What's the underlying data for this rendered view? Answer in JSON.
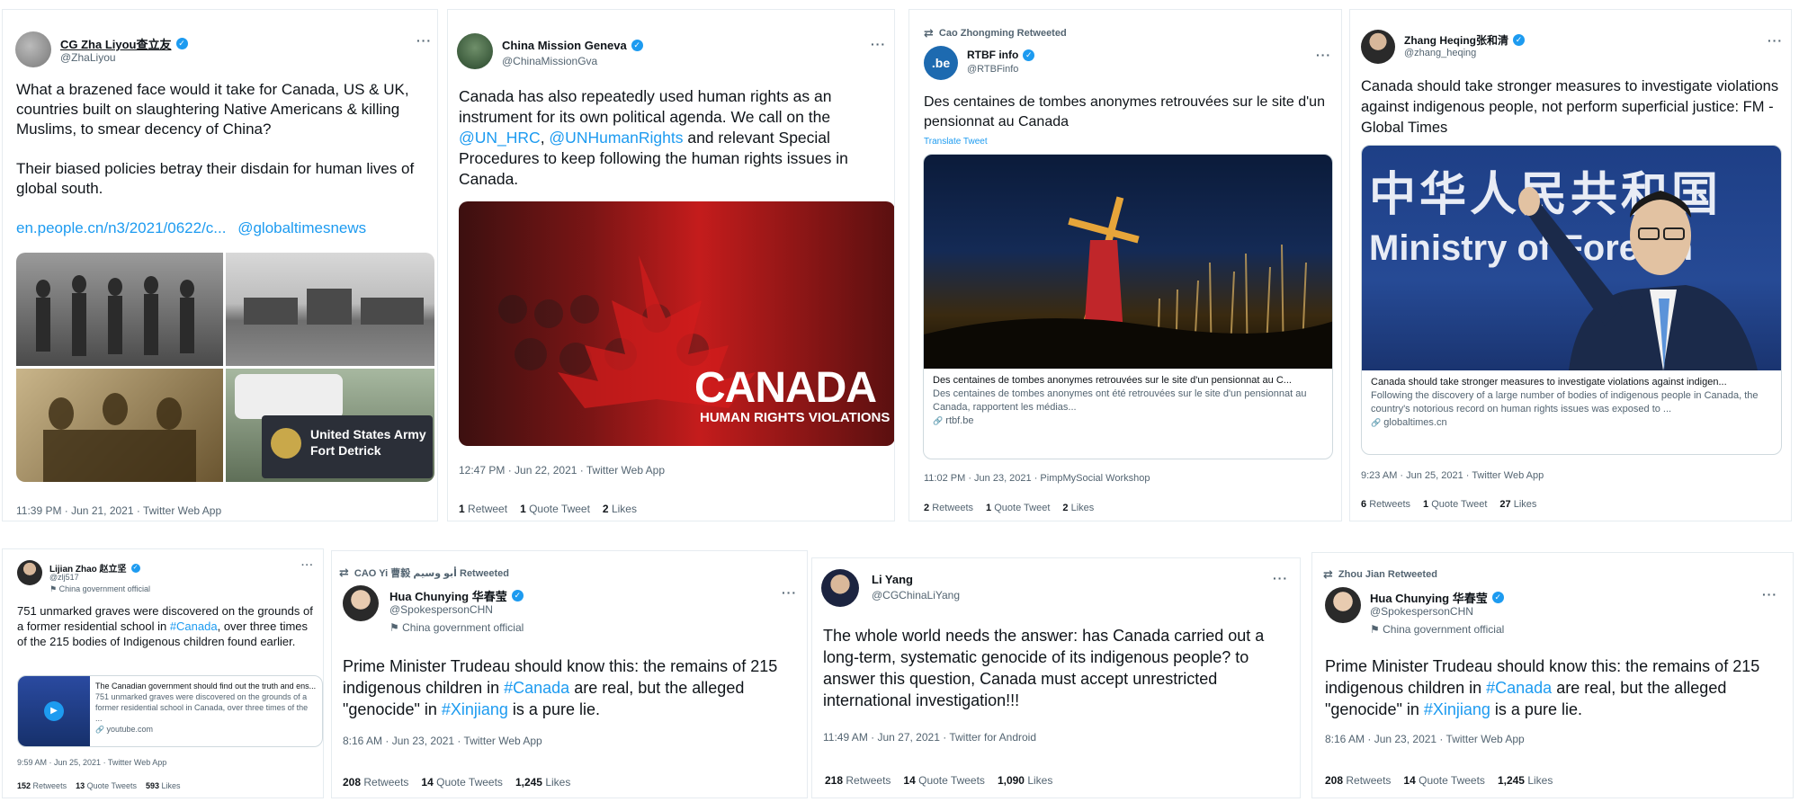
{
  "tweets": [
    {
      "name": "CG Zha Liyou查立友",
      "handle": "@ZhaLiyou",
      "text1": "What a brazened face would it take for Canada, US & UK, countries built on slaughtering Native Americans & killing Muslims, to smear decency of China?",
      "text2": "Their biased policies betray their disdain for human lives of global south.",
      "link": "en.people.cn/n3/2021/0622/c...",
      "mention": "@globaltimesnews",
      "overlay_label": "United States Army Fort Detrick",
      "meta": "11:39 PM · Jun 21, 2021 · Twitter Web App"
    },
    {
      "name": "China Mission Geneva",
      "handle": "@ChinaMissionGva",
      "text_a": "Canada has also repeatedly used human rights as an instrument for its own political agenda. We call on the ",
      "mention1": "@UN_HRC",
      "sep": ", ",
      "mention2": "@UNHumanRights",
      "text_b": " and relevant Special Procedures to keep following the human rights issues in Canada.",
      "image_title": "CANADA",
      "image_subtitle": "HUMAN RIGHTS VIOLATIONS",
      "meta": "12:47 PM · Jun 22, 2021 · Twitter Web App",
      "stats": [
        {
          "num": "1",
          "label": "Retweet"
        },
        {
          "num": "1",
          "label": "Quote Tweet"
        },
        {
          "num": "2",
          "label": "Likes"
        }
      ]
    },
    {
      "retweeted_by": "Cao Zhongming Retweeted",
      "name": "RTBF info",
      "handle": "@RTBFinfo",
      "avatar_text": ".be",
      "text": "Des centaines de tombes anonymes retrouvées sur le site d'un pensionnat au Canada",
      "translate": "Translate Tweet",
      "card_title": "Des centaines de tombes anonymes retrouvées sur le site d'un pensionnat au C...",
      "card_desc": "Des centaines de tombes anonymes ont été retrouvées sur le site d'un pensionnat au Canada, rapportent les médias...",
      "card_domain": "rtbf.be",
      "meta": "11:02 PM · Jun 23, 2021 · PimpMySocial Workshop",
      "stats": [
        {
          "num": "2",
          "label": "Retweets"
        },
        {
          "num": "1",
          "label": "Quote Tweet"
        },
        {
          "num": "2",
          "label": "Likes"
        }
      ]
    },
    {
      "name": "Zhang Heqing张和清",
      "handle": "@zhang_heqing",
      "text": "Canada should take stronger measures to investigate violations against indigenous people, not perform superficial justice: FM - Global Times",
      "image_zh": "中华人民共和国",
      "image_en": "Ministry of Foreign",
      "card_title": "Canada should take stronger measures to investigate violations against indigen...",
      "card_desc": "Following the discovery of a large number of bodies of indigenous people in Canada, the country's notorious record on human rights issues was exposed to ...",
      "card_domain": "globaltimes.cn",
      "meta": "9:23 AM · Jun 25, 2021 · Twitter Web App",
      "stats": [
        {
          "num": "6",
          "label": "Retweets"
        },
        {
          "num": "1",
          "label": "Quote Tweet"
        },
        {
          "num": "27",
          "label": "Likes"
        }
      ]
    },
    {
      "name": "Lijian Zhao 赵立坚",
      "handle": "@zlj517",
      "official": "China government official",
      "text_a": "751 unmarked graves were discovered on the grounds of a former residential school in ",
      "hashtag": "#Canada",
      "text_b": ", over three times of the 215 bodies of Indigenous children found earlier.",
      "card_title": "The Canadian government should find out the truth and ens...",
      "card_desc": "751 unmarked graves were discovered on the grounds of a former residential school in Canada, over three times of the ...",
      "card_domain": "youtube.com",
      "meta": "9:59 AM · Jun 25, 2021 · Twitter Web App",
      "stats": [
        {
          "num": "152",
          "label": "Retweets"
        },
        {
          "num": "13",
          "label": "Quote Tweets"
        },
        {
          "num": "593",
          "label": "Likes"
        }
      ]
    },
    {
      "retweeted_by": "CAO Yi 曹毅 أبو وسيم Retweeted",
      "name": "Hua Chunying 华春莹",
      "handle": "@SpokespersonCHN",
      "official": "China government official",
      "text_a": "Prime Minister Trudeau should know this: the remains of 215 indigenous children in ",
      "hashtag1": "#Canada",
      "text_b": " are real, but the alleged \"genocide\" in  ",
      "hashtag2": "#Xinjiang",
      "text_c": " is a pure lie.",
      "meta": "8:16 AM · Jun 23, 2021 · Twitter Web App",
      "stats": [
        {
          "num": "208",
          "label": "Retweets"
        },
        {
          "num": "14",
          "label": "Quote Tweets"
        },
        {
          "num": "1,245",
          "label": "Likes"
        }
      ]
    },
    {
      "name": "Li Yang",
      "handle": "@CGChinaLiYang",
      "text": "The whole world needs the answer: has Canada carried out a long-term, systematic genocide of its indigenous people? to answer this question, Canada must accept unrestricted international investigation!!!",
      "meta": "11:49 AM · Jun 27, 2021 · Twitter for Android",
      "stats": [
        {
          "num": "218",
          "label": "Retweets"
        },
        {
          "num": "14",
          "label": "Quote Tweets"
        },
        {
          "num": "1,090",
          "label": "Likes"
        }
      ]
    },
    {
      "retweeted_by": "Zhou Jian Retweeted",
      "name": "Hua Chunying 华春莹",
      "handle": "@SpokespersonCHN",
      "official": "China government official",
      "text_a": "Prime Minister Trudeau should know this: the remains of 215 indigenous children in ",
      "hashtag1": "#Canada",
      "text_b": " are real, but the alleged \"genocide\" in  ",
      "hashtag2": "#Xinjiang",
      "text_c": " is a pure lie.",
      "meta": "8:16 AM · Jun 23, 2021 · Twitter Web App",
      "stats": [
        {
          "num": "208",
          "label": "Retweets"
        },
        {
          "num": "14",
          "label": "Quote Tweets"
        },
        {
          "num": "1,245",
          "label": "Likes"
        }
      ]
    }
  ],
  "more_label": "···",
  "flag_icon": "⚑",
  "link_icon": "🔗"
}
